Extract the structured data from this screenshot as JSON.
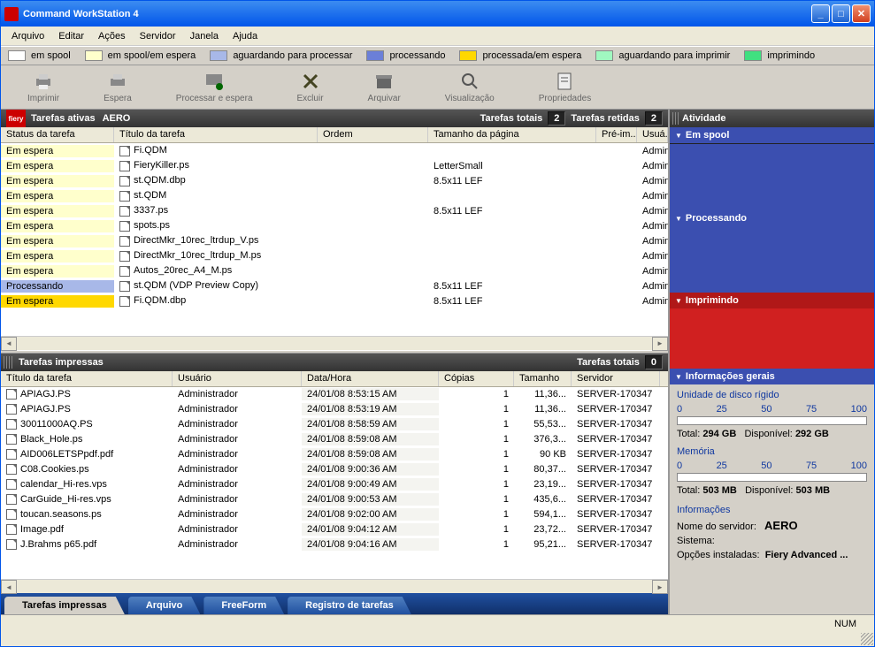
{
  "window": {
    "title": "Command WorkStation 4"
  },
  "menu": [
    "Arquivo",
    "Editar",
    "Ações",
    "Servidor",
    "Janela",
    "Ajuda"
  ],
  "legend": [
    {
      "color": "#ffffff",
      "label": "em spool"
    },
    {
      "color": "#ffffcc",
      "label": "em spool/em espera"
    },
    {
      "color": "#a8b8e8",
      "label": "aguardando para processar"
    },
    {
      "color": "#6b7fd8",
      "label": "processando"
    },
    {
      "color": "#ffd800",
      "label": "processada/em espera"
    },
    {
      "color": "#a0f8c0",
      "label": "aguardando para imprimir"
    },
    {
      "color": "#40e080",
      "label": "imprimindo"
    }
  ],
  "toolbar": [
    {
      "name": "print",
      "label": "Imprimir"
    },
    {
      "name": "hold",
      "label": "Espera"
    },
    {
      "name": "process-hold",
      "label": "Processar e espera"
    },
    {
      "name": "delete",
      "label": "Excluir"
    },
    {
      "name": "archive",
      "label": "Arquivar"
    },
    {
      "name": "preview",
      "label": "Visualização"
    },
    {
      "name": "properties",
      "label": "Propriedades"
    }
  ],
  "active": {
    "title": "Tarefas ativas",
    "server": "AERO",
    "totals_label": "Tarefas totais",
    "totals": "2",
    "held_label": "Tarefas retidas",
    "held": "2",
    "columns": [
      "Status da tarefa",
      "Título da tarefa",
      "Ordem",
      "Tamanho da página",
      "Pré-im...",
      "Usuá..."
    ],
    "rows": [
      {
        "bg": "bg-cream",
        "status": "Em espera",
        "title": "Fi.QDM",
        "size": "",
        "user": "Admin"
      },
      {
        "bg": "bg-cream",
        "status": "Em espera",
        "title": "FieryKiller.ps",
        "size": "LetterSmall",
        "user": "Admin"
      },
      {
        "bg": "bg-cream",
        "status": "Em espera",
        "title": "st.QDM.dbp",
        "size": "8.5x11 LEF",
        "user": "Admin"
      },
      {
        "bg": "bg-cream",
        "status": "Em espera",
        "title": "st.QDM",
        "size": "",
        "user": "Admin"
      },
      {
        "bg": "bg-cream",
        "status": "Em espera",
        "title": "3337.ps",
        "size": "8.5x11 LEF",
        "user": "Admin"
      },
      {
        "bg": "bg-cream",
        "status": "Em espera",
        "title": "spots.ps",
        "size": "",
        "user": "Admin"
      },
      {
        "bg": "bg-cream",
        "status": "Em espera",
        "title": "DirectMkr_10rec_ltrdup_V.ps",
        "size": "",
        "user": "Admin"
      },
      {
        "bg": "bg-cream",
        "status": "Em espera",
        "title": "DirectMkr_10rec_ltrdup_M.ps",
        "size": "",
        "user": "Admin"
      },
      {
        "bg": "bg-cream",
        "status": "Em espera",
        "title": "Autos_20rec_A4_M.ps",
        "size": "",
        "user": "Admin"
      },
      {
        "bg": "bg-lav",
        "status": "Processando",
        "title": "st.QDM (VDP Preview Copy)",
        "size": "8.5x11 LEF",
        "user": "Admin"
      },
      {
        "bg": "bg-yellow",
        "status": "Em espera",
        "title": "Fi.QDM.dbp",
        "size": "8.5x11 LEF",
        "user": "Admin"
      }
    ]
  },
  "printed": {
    "title": "Tarefas impressas",
    "totals_label": "Tarefas totais",
    "totals": "0",
    "columns": [
      "Título da tarefa",
      "Usuário",
      "Data/Hora",
      "Cópias",
      "Tamanho",
      "Servidor"
    ],
    "rows": [
      {
        "title": "APIAGJ.PS",
        "user": "Administrador",
        "date": "24/01/08 8:53:15 AM",
        "copies": "1",
        "size": "11,36...",
        "server": "SERVER-170347"
      },
      {
        "title": "APIAGJ.PS",
        "user": "Administrador",
        "date": "24/01/08 8:53:19 AM",
        "copies": "1",
        "size": "11,36...",
        "server": "SERVER-170347"
      },
      {
        "title": "30011000AQ.PS",
        "user": "Administrador",
        "date": "24/01/08 8:58:59 AM",
        "copies": "1",
        "size": "55,53...",
        "server": "SERVER-170347"
      },
      {
        "title": "Black_Hole.ps",
        "user": "Administrador",
        "date": "24/01/08 8:59:08 AM",
        "copies": "1",
        "size": "376,3...",
        "server": "SERVER-170347"
      },
      {
        "title": "AID006LETSPpdf.pdf",
        "user": "Administrador",
        "date": "24/01/08 8:59:08 AM",
        "copies": "1",
        "size": "90 KB",
        "server": "SERVER-170347"
      },
      {
        "title": "C08.Cookies.ps",
        "user": "Administrador",
        "date": "24/01/08 9:00:36 AM",
        "copies": "1",
        "size": "80,37...",
        "server": "SERVER-170347"
      },
      {
        "title": "calendar_Hi-res.vps",
        "user": "Administrador",
        "date": "24/01/08 9:00:49 AM",
        "copies": "1",
        "size": "23,19...",
        "server": "SERVER-170347"
      },
      {
        "title": "CarGuide_Hi-res.vps",
        "user": "Administrador",
        "date": "24/01/08 9:00:53 AM",
        "copies": "1",
        "size": "435,6...",
        "server": "SERVER-170347"
      },
      {
        "title": "toucan.seasons.ps",
        "user": "Administrador",
        "date": "24/01/08 9:02:00 AM",
        "copies": "1",
        "size": "594,1...",
        "server": "SERVER-170347"
      },
      {
        "title": "Image.pdf",
        "user": "Administrador",
        "date": "24/01/08 9:04:12 AM",
        "copies": "1",
        "size": "23,72...",
        "server": "SERVER-170347"
      },
      {
        "title": "J.Brahms p65.pdf",
        "user": "Administrador",
        "date": "24/01/08 9:04:16 AM",
        "copies": "1",
        "size": "95,21...",
        "server": "SERVER-170347"
      }
    ]
  },
  "tabs": [
    {
      "label": "Tarefas impressas",
      "active": true
    },
    {
      "label": "Arquivo",
      "active": false
    },
    {
      "label": "FreeForm",
      "active": false
    },
    {
      "label": "Registro de tarefas",
      "active": false
    }
  ],
  "activity": {
    "title": "Atividade",
    "spool": "Em spool",
    "processing": "Processando",
    "printing": "Imprimindo",
    "info_title": "Informações gerais",
    "disk_label": "Unidade de disco rígido",
    "ticks": [
      "0",
      "25",
      "50",
      "75",
      "100"
    ],
    "disk_total_label": "Total:",
    "disk_total": "294 GB",
    "disk_avail_label": "Disponível:",
    "disk_avail": "292 GB",
    "mem_label": "Memória",
    "mem_total_label": "Total:",
    "mem_total": "503 MB",
    "mem_avail_label": "Disponível:",
    "mem_avail": "503 MB",
    "info_section": "Informações",
    "server_name_label": "Nome do servidor:",
    "server_name": "AERO",
    "system_label": "Sistema:",
    "options_label": "Opções instaladas:",
    "options": "Fiery Advanced ..."
  },
  "status": {
    "num": "NUM"
  }
}
